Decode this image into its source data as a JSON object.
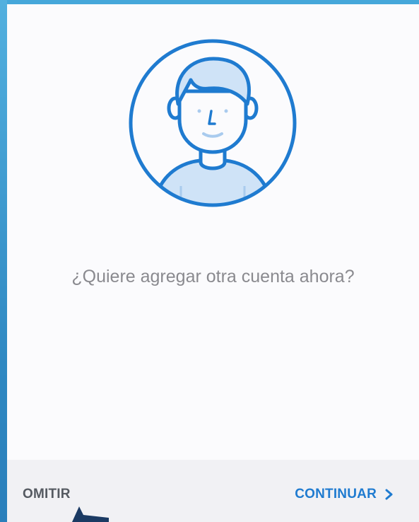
{
  "screen": {
    "question": "¿Quiere agregar otra cuenta ahora?"
  },
  "footer": {
    "skip_label": "OMITIR",
    "continue_label": "CONTINUAR"
  },
  "icons": {
    "avatar": "user-avatar-icon",
    "continue": "chevron-right-icon",
    "cursor": "mouse-pointer-icon"
  },
  "colors": {
    "accent": "#1f7bd0",
    "avatar_fill": "#cfe3f7",
    "text_muted": "#8a8a8f",
    "footer_bg": "#f1f1f4",
    "frame": "#3a9dd1"
  }
}
